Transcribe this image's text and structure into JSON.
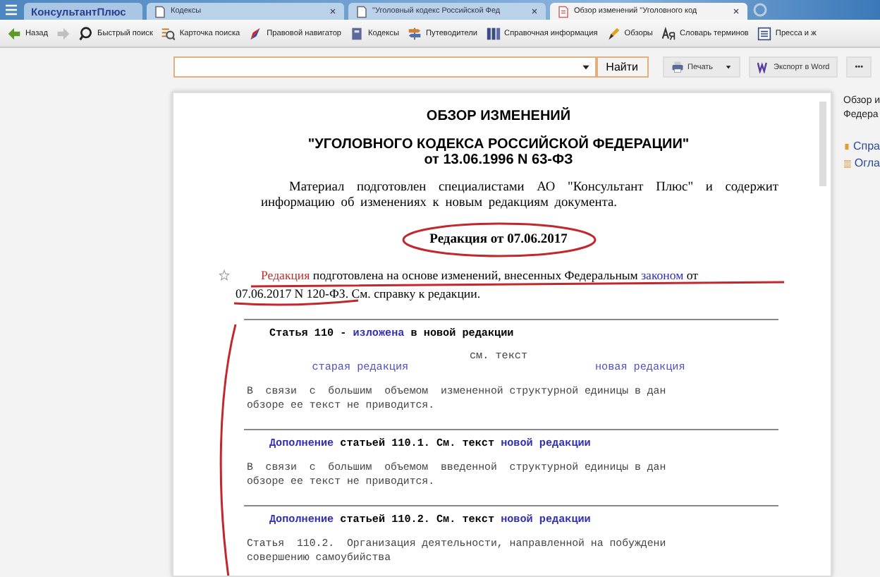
{
  "tabs": [
    {
      "label": "КонсультантПлюс",
      "kind": "logo",
      "selected": false
    },
    {
      "label": "Кодексы",
      "kind": "doc",
      "selected": false
    },
    {
      "label": "\"Уголовный кодекс Российской Фед",
      "kind": "doc",
      "selected": false
    },
    {
      "label": "Обзор изменений \"Уголовного код",
      "kind": "review",
      "selected": true
    }
  ],
  "toolbar": [
    {
      "label": "Назад",
      "disabled": false
    },
    {
      "disabled": true
    },
    {
      "label": "Быстрый поиск",
      "disabled": false
    },
    {
      "label": "Карточка поиска",
      "disabled": false
    },
    {
      "label": "Правовой навигатор",
      "disabled": false
    },
    {
      "label": "Кодексы",
      "disabled": false
    },
    {
      "label": "Путеводители",
      "disabled": false
    },
    {
      "label": "Справочная информация",
      "disabled": false
    },
    {
      "label": "Обзоры",
      "disabled": false
    },
    {
      "label": "Словарь терминов",
      "disabled": false
    },
    {
      "label": "Пресса и ж",
      "disabled": false
    }
  ],
  "search": {
    "button": "Найти"
  },
  "actions": [
    {
      "label": "Печать"
    },
    {
      "label": "Экспорт в Word"
    },
    {
      "label": "•••"
    }
  ],
  "document": {
    "blocks": [
      {
        "kind": "title",
        "text": "ОБЗОР ИЗМЕНЕНИЙ"
      },
      {
        "kind": "title2",
        "text": "\"УГОЛОВНОГО КОДЕКСА РОССИЙСКОЙ ФЕДЕРАЦИИ\""
      },
      {
        "kind": "title3",
        "text": "от 13.06.1996 N 63-ФЗ"
      },
      {
        "kind": "para",
        "text": "Материал подготовлен специалистами АО \"Консультант Плюс\" и содержит информацию об изменениях к новым редакциям документа."
      },
      {
        "kind": "edition",
        "text": "Редакция от 07.06.2017"
      },
      {
        "kind": "basis",
        "parts": [
          {
            "text": "Редакция",
            "kind": "red_link"
          },
          {
            "text": " подготовлена на основе изменений, внесенных Федеральным ",
            "kind": "text"
          },
          {
            "text": "законом",
            "kind": "link"
          },
          {
            "text": " от",
            "kind": "text"
          },
          {
            "text": "07.06.2017 N 120-ФЗ.",
            "kind": "marked"
          },
          {
            "text": " См. справку к редакции.",
            "kind": "text"
          }
        ]
      },
      {
        "kind": "rule"
      },
      {
        "kind": "head",
        "parts": [
          {
            "text": "Статья 110 - ",
            "kind": "text"
          },
          {
            "text": "изложена",
            "kind": "link"
          },
          {
            "text": " в новой редакции",
            "kind": "text"
          }
        ]
      },
      {
        "kind": "center",
        "text": "см. текст"
      },
      {
        "kind": "pair",
        "items": [
          "старая редакция",
          "новая редакция"
        ]
      },
      {
        "kind": "mono",
        "text": "В  связи  с  большим  объемом  измененной структурной единицы в дан\nобзоре ее текст не приводится."
      },
      {
        "kind": "rule"
      },
      {
        "kind": "head",
        "parts": [
          {
            "text": "Дополнение",
            "kind": "link"
          },
          {
            "text": " статьей 110.1. См. текст ",
            "kind": "text"
          },
          {
            "text": "новой редакции",
            "kind": "link"
          }
        ]
      },
      {
        "kind": "mono",
        "text": "В  связи  с  большим  объемом  введенной  структурной единицы в дан\nобзоре ее текст не приводится."
      },
      {
        "kind": "rule"
      },
      {
        "kind": "head",
        "parts": [
          {
            "text": "Дополнение",
            "kind": "link"
          },
          {
            "text": " статьей 110.2. См. текст ",
            "kind": "text"
          },
          {
            "text": "новой редакции",
            "kind": "link"
          }
        ]
      },
      {
        "kind": "mono",
        "text": "Статья  110.2.  Организация деятельности, направленной на побуждени\nсовершению самоубийства"
      }
    ]
  },
  "side": {
    "title_lines": [
      "Обзор и",
      "Федера"
    ],
    "links": [
      {
        "label": "Спра"
      },
      {
        "label": "Огла"
      }
    ]
  }
}
